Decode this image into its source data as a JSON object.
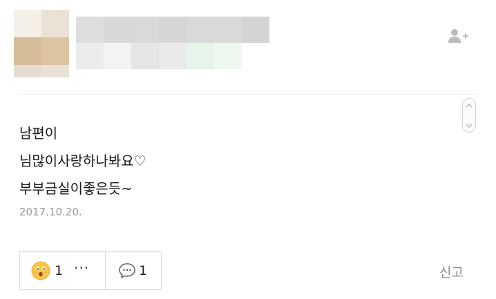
{
  "post": {
    "lines": [
      "남편이",
      "님많이사랑하나봐요♡",
      "부부금실이좋은듯~"
    ],
    "date": "2017.10.20."
  },
  "actions": {
    "reaction_count": "1",
    "more_label": "···",
    "comment_count": "1",
    "report_label": "신고"
  },
  "icons": {
    "follow": "add-user-icon",
    "reaction": "surprised-emoji-icon",
    "comment": "speech-bubble-icon",
    "scroll_up": "chevron-up-icon",
    "scroll_down": "chevron-down-icon"
  },
  "colors": {
    "text": "#1a1a1a",
    "muted": "#9a9a9a",
    "border": "#dcdcdc",
    "emoji": "#f7c64a"
  }
}
